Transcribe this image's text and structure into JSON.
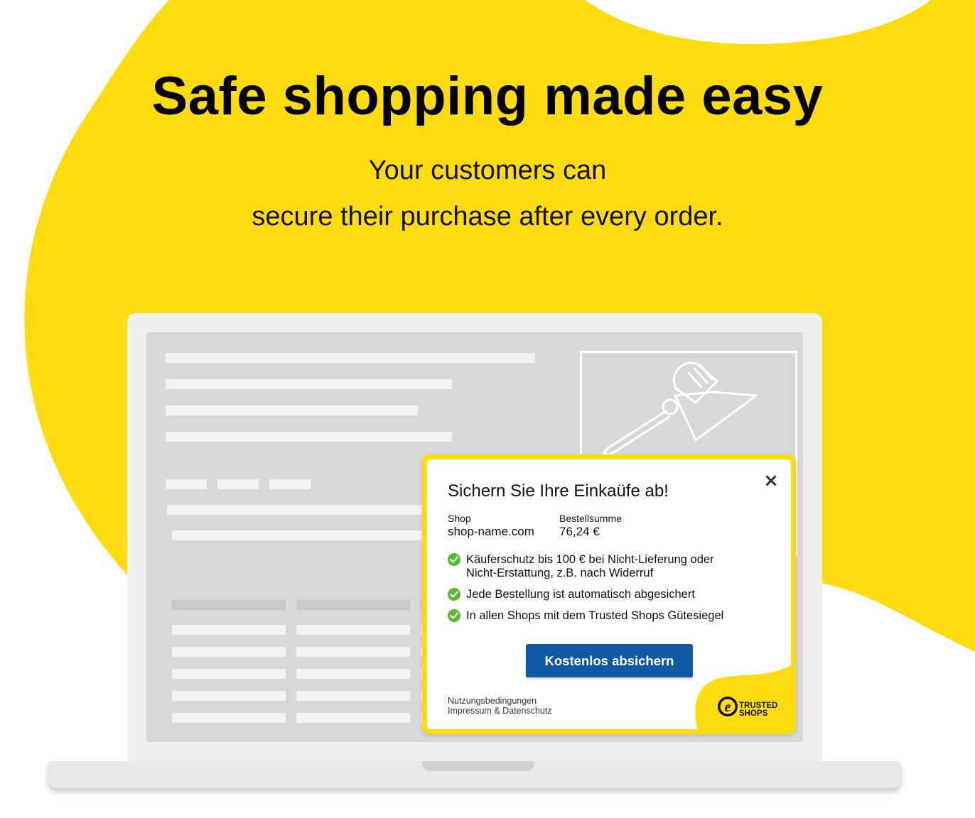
{
  "hero": {
    "headline": "Safe shopping made easy",
    "subline_1": "Your customers can",
    "subline_2": "secure their purchase after every order."
  },
  "popup": {
    "title": "Sichern Sie Ihre Einkaüfe ab!",
    "close_icon": "close-icon",
    "shop_label": "Shop",
    "shop_value": "shop-name.com",
    "total_label": "Bestellsumme",
    "total_value": "76,24 €",
    "benefits": [
      "Käuferschutz bis 100 € bei Nicht-Lieferung oder",
      "Nicht-Erstattung, z.B. nach Widerruf",
      "Jede Bestellung ist automatisch abgesichert",
      "In allen Shops mit dem Trusted Shops Gütesiegel"
    ],
    "cta_label": "Kostenlos absichern",
    "terms_link": "Nutzungsbedingungen",
    "imprint_link": "Impressum & Datenschutz",
    "logo_line_1": "TRUSTED",
    "logo_line_2": "SHOPS"
  },
  "colors": {
    "brand_yellow": "#FFDC0F",
    "cta_blue": "#0F58A3",
    "check_green": "#5CB82E",
    "placeholder_gray": "#D9D9D9"
  },
  "icons": [
    "close-icon",
    "check-circle-icon",
    "lamp-illustration",
    "trusted-shops-logo"
  ]
}
